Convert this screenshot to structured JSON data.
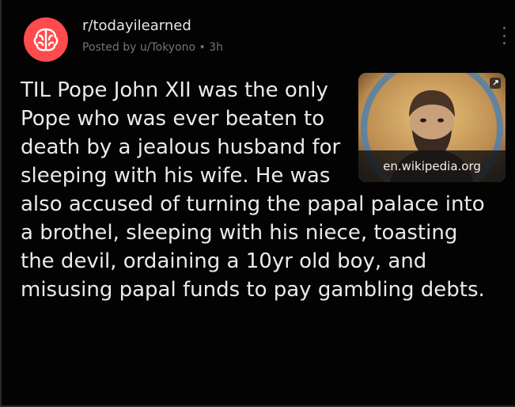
{
  "post": {
    "subreddit": "r/todayilearned",
    "meta": "Posted by u/Tokyono • 3h",
    "title": "TIL Pope John XII was the only Pope who was ever beaten to death by a jealous husband for sleeping with his wife. He was also accused of turning the papal palace into a brothel, sleeping with his niece, toasting the devil, ordaining a 10yr old boy, and misusing papal funds to pay gambling debts.",
    "link_domain": "en.wikipedia.org"
  },
  "icons": {
    "subreddit_avatar": "brain-icon",
    "menu": "more-vertical-icon",
    "thumbnail": "portrait-image"
  },
  "colors": {
    "background": "#030303",
    "avatar": "#ff4b4b",
    "text": "#e9eaeb",
    "meta": "#6f7478"
  }
}
